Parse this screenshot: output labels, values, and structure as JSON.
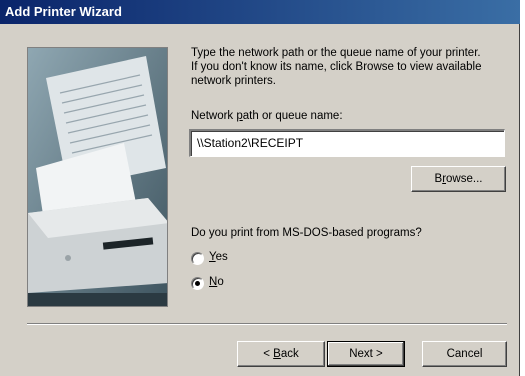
{
  "window": {
    "title": "Add Printer Wizard"
  },
  "instructions": {
    "line1": "Type the network path or the queue name of your printer.",
    "line2": "If you don't know its name, click Browse to view available",
    "line3": "network printers."
  },
  "path_field": {
    "label_pre": "Network ",
    "label_accel": "p",
    "label_post": "ath or queue name:",
    "value": "\\\\Station2\\RECEIPT"
  },
  "browse_button": {
    "pre": "B",
    "accel": "r",
    "post": "owse..."
  },
  "msdos": {
    "question": "Do you print from MS-DOS-based programs?",
    "options": [
      {
        "accel": "Y",
        "rest": "es",
        "selected": false
      },
      {
        "accel": "N",
        "rest": "o",
        "selected": true
      }
    ]
  },
  "footer": {
    "back": {
      "pre": "< ",
      "accel": "B",
      "post": "ack"
    },
    "next": {
      "label": "Next >"
    },
    "cancel": {
      "label": "Cancel"
    }
  },
  "colors": {
    "title_bar_start": "#0a246a",
    "title_bar_end": "#3a6ea5",
    "dialog_face": "#d4d0c8"
  }
}
